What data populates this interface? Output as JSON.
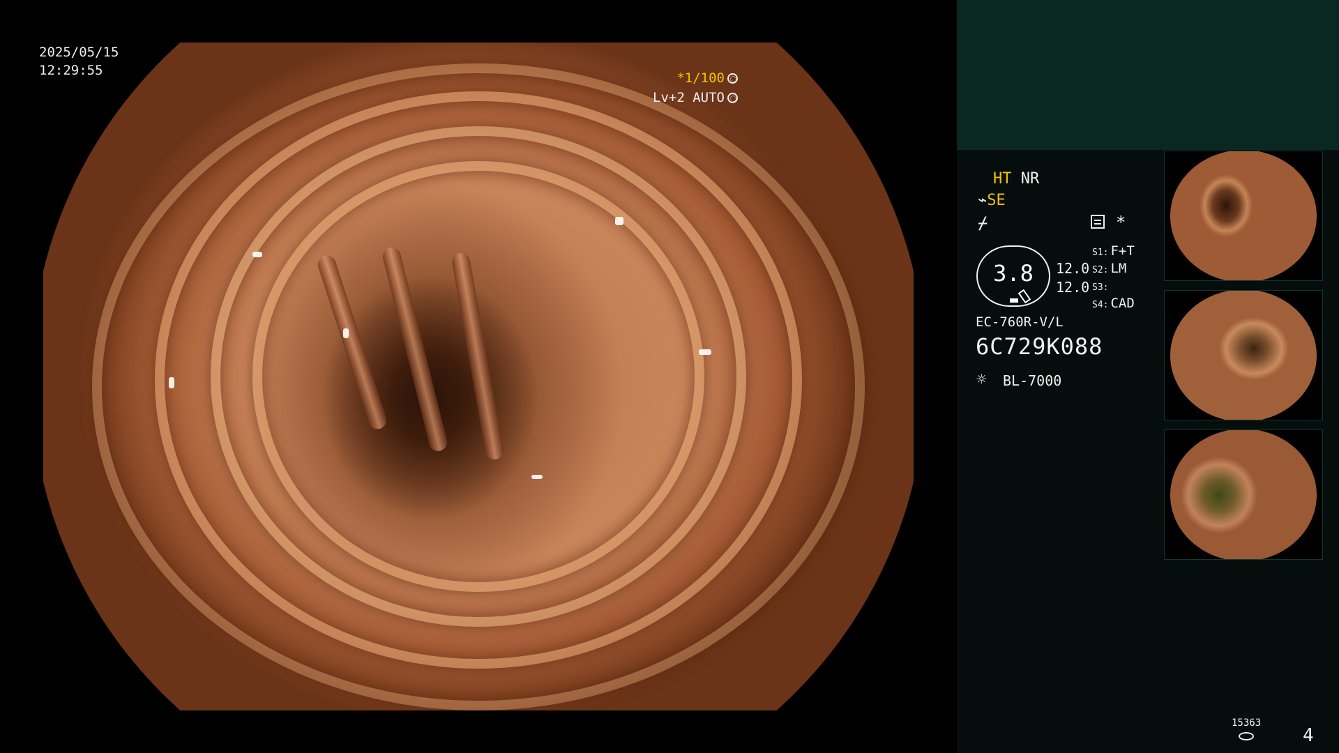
{
  "overlay": {
    "date": "2025/05/15",
    "time": "12:29:55",
    "shutter": "*1/100",
    "level": "Lv+2 AUTO"
  },
  "panel": {
    "mode_ht": "HT",
    "mode_nr": "NR",
    "mode_se": "SE",
    "dial_value": "3.8",
    "fov_1": "12.0",
    "fov_2": "12.0",
    "switches": [
      {
        "key": "S1:",
        "value": "F+T"
      },
      {
        "key": "S2:",
        "value": "LM"
      },
      {
        "key": "S3:",
        "value": ""
      },
      {
        "key": "S4:",
        "value": "CAD"
      }
    ],
    "scope_model": "EC-760R-V/L",
    "scope_serial": "6C729K088",
    "light_source": "BL-7000",
    "counter": "15363",
    "page_number": "4"
  },
  "icons": {
    "shutter": "aperture-icon",
    "level": "auto-iris-icon",
    "structure": "structure-enhancement-icon",
    "light": "light-source-icon"
  },
  "colors": {
    "accent_yellow": "#f3c200",
    "panel_bg": "#050e0c",
    "panel_top_bg": "#0b2722"
  }
}
